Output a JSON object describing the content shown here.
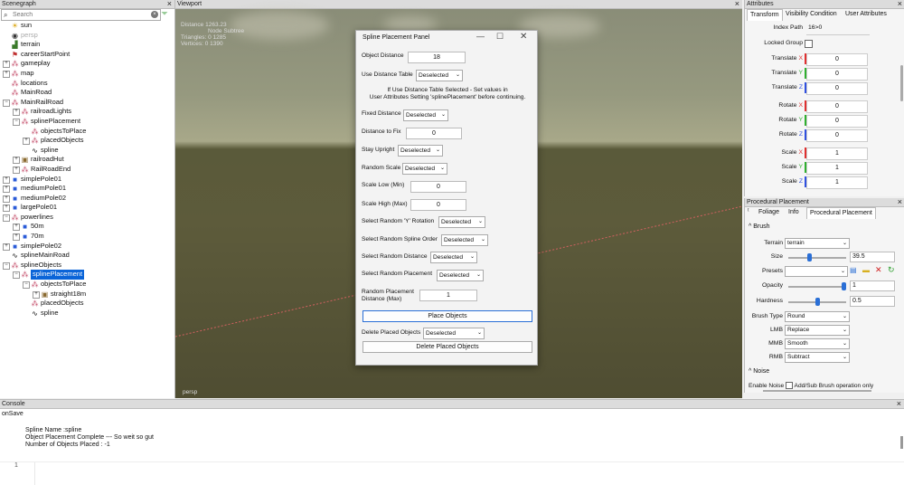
{
  "scenegraph": {
    "title": "Scenegraph",
    "search_placeholder": "Search",
    "nodes": [
      {
        "label": "sun",
        "depth": 0,
        "icon": "sun-icon"
      },
      {
        "label": "persp",
        "depth": 0,
        "icon": "camera-icon",
        "dim": true
      },
      {
        "label": "terrain",
        "depth": 0,
        "icon": "terrain-icon"
      },
      {
        "label": "careerStartPoint",
        "depth": 0,
        "icon": "object-icon"
      },
      {
        "label": "gameplay",
        "depth": 0,
        "icon": "group-icon",
        "expandable": true
      },
      {
        "label": "map",
        "depth": 0,
        "icon": "group-icon",
        "expandable": true
      },
      {
        "label": "locations",
        "depth": 0,
        "icon": "group-icon"
      },
      {
        "label": "MainRoad",
        "depth": 0,
        "icon": "group-icon"
      },
      {
        "label": "MainRailRoad",
        "depth": 0,
        "icon": "group-icon",
        "expandable": true,
        "open": true
      },
      {
        "label": "railroadLights",
        "depth": 1,
        "icon": "group-icon",
        "expandable": true
      },
      {
        "label": "splinePlacement",
        "depth": 1,
        "icon": "group-icon",
        "expandable": true,
        "open": true
      },
      {
        "label": "objectsToPlace",
        "depth": 2,
        "icon": "group-icon"
      },
      {
        "label": "placedObjects",
        "depth": 2,
        "icon": "group-icon",
        "expandable": true
      },
      {
        "label": "spline",
        "depth": 2,
        "icon": "spline-icon"
      },
      {
        "label": "railroadHut",
        "depth": 1,
        "icon": "model-icon",
        "expandable": true
      },
      {
        "label": "RailRoadEnd",
        "depth": 1,
        "icon": "group-icon",
        "expandable": true
      },
      {
        "label": "simplePole01",
        "depth": 0,
        "icon": "cube-icon",
        "expandable": true
      },
      {
        "label": "mediumPole01",
        "depth": 0,
        "icon": "cube-icon",
        "expandable": true
      },
      {
        "label": "mediumPole02",
        "depth": 0,
        "icon": "cube-icon",
        "expandable": true
      },
      {
        "label": "largePole01",
        "depth": 0,
        "icon": "cube-icon",
        "expandable": true
      },
      {
        "label": "powerlines",
        "depth": 0,
        "icon": "group-icon",
        "expandable": true,
        "open": true
      },
      {
        "label": "50m",
        "depth": 1,
        "icon": "cube-icon",
        "expandable": true
      },
      {
        "label": "70m",
        "depth": 1,
        "icon": "cube-icon",
        "expandable": true
      },
      {
        "label": "simplePole02",
        "depth": 0,
        "icon": "cube-icon",
        "expandable": true
      },
      {
        "label": "splineMainRoad",
        "depth": 0,
        "icon": "spline-icon"
      },
      {
        "label": "splineObjects",
        "depth": 0,
        "icon": "group-icon",
        "expandable": true,
        "open": true
      },
      {
        "label": "splinePlacement",
        "depth": 1,
        "icon": "group-icon",
        "expandable": true,
        "open": true,
        "selected": true
      },
      {
        "label": "objectsToPlace",
        "depth": 2,
        "icon": "group-icon",
        "expandable": true,
        "open": true
      },
      {
        "label": "straight18m",
        "depth": 3,
        "icon": "model-icon",
        "expandable": true
      },
      {
        "label": "placedObjects",
        "depth": 2,
        "icon": "group-icon"
      },
      {
        "label": "spline",
        "depth": 2,
        "icon": "spline-icon"
      }
    ]
  },
  "viewport": {
    "title": "Viewport",
    "stats": [
      "Distance 1263.23",
      "Node Subtree",
      "Triangles: 0      1285",
      "Vertices:   0      1390"
    ],
    "camera_label": "persp"
  },
  "panel": {
    "title": "Spline Placement Panel",
    "object_distance_label": "Object Distance",
    "object_distance_value": "18",
    "use_distance_table_label": "Use Distance Table",
    "use_distance_table_value": "Deselected",
    "note_line1": "If Use Distance Table Selected - Set values in",
    "note_line2": "User Attributes Setting 'splinePlacement' before continuing.",
    "fixed_distance_label": "Fixed Distance",
    "fixed_distance_value": "Deselected",
    "distance_to_fix_label": "Distance to Fix",
    "distance_to_fix_value": "0",
    "stay_upright_label": "Stay Upright",
    "stay_upright_value": "Deselected",
    "random_scale_label": "Random Scale",
    "random_scale_value": "Deselected",
    "scale_low_label": "Scale Low (Min)",
    "scale_low_value": "0",
    "scale_high_label": "Scale High (Max)",
    "scale_high_value": "0",
    "rand_y_rot_label": "Select Random 'Y' Rotation",
    "rand_y_rot_value": "Deselected",
    "rand_spline_order_label": "Select Random Spline Order",
    "rand_spline_order_value": "Deselected",
    "rand_distance_label": "Select Random Distance",
    "rand_distance_value": "Deselected",
    "rand_placement_label": "Select Random Placement",
    "rand_placement_value": "Deselected",
    "rand_place_dist_label1": "Random Placement",
    "rand_place_dist_label2": "Distance (Max)",
    "rand_place_dist_value": "1",
    "place_objects_button": "Place Objects",
    "delete_placed_label": "Delete Placed Objects",
    "delete_placed_value": "Deselected",
    "delete_placed_button": "Delete Placed Objects"
  },
  "attributes": {
    "title": "Attributes",
    "tabs": [
      "Transform",
      "Visibility Condition",
      "User Attributes"
    ],
    "index_path_label": "Index Path",
    "index_path_value": "16>0",
    "locked_group_label": "Locked Group",
    "fields": [
      {
        "label": "Translate",
        "axis": "X",
        "value": "0",
        "axis_color": "#e03030"
      },
      {
        "label": "Translate",
        "axis": "Y",
        "value": "0",
        "axis_color": "#30b030"
      },
      {
        "label": "Translate",
        "axis": "Z",
        "value": "0",
        "axis_color": "#3050e0"
      },
      {
        "label": "Rotate",
        "axis": "X",
        "value": "0",
        "axis_color": "#e03030"
      },
      {
        "label": "Rotate",
        "axis": "Y",
        "value": "0",
        "axis_color": "#30b030"
      },
      {
        "label": "Rotate",
        "axis": "Z",
        "value": "0",
        "axis_color": "#3050e0"
      },
      {
        "label": "Scale",
        "axis": "X",
        "value": "1",
        "axis_color": "#e03030"
      },
      {
        "label": "Scale",
        "axis": "Y",
        "value": "1",
        "axis_color": "#30b030"
      },
      {
        "label": "Scale",
        "axis": "Z",
        "value": "1",
        "axis_color": "#3050e0"
      }
    ]
  },
  "procedural": {
    "title": "Procedural Placement",
    "tabs": [
      "Foliage",
      "Info",
      "Procedural Placement"
    ],
    "brush_section": "Brush",
    "terrain_label": "Terrain",
    "terrain_value": "terrain",
    "size_label": "Size",
    "size_value": "39.5",
    "size_fraction": 0.35,
    "presets_label": "Presets",
    "opacity_label": "Opacity",
    "opacity_value": "1",
    "opacity_fraction": 1.0,
    "hardness_label": "Hardness",
    "hardness_value": "0.5",
    "hardness_fraction": 0.5,
    "brush_type_label": "Brush Type",
    "brush_type_value": "Round",
    "lmb_label": "LMB",
    "lmb_value": "Replace",
    "mmb_label": "MMB",
    "mmb_value": "Smooth",
    "rmb_label": "RMB",
    "rmb_value": "Subtract",
    "noise_section": "Noise",
    "enable_noise_label": "Enable Noise",
    "add_sub_label": "Add/Sub Brush operation only"
  },
  "console": {
    "title": "Console",
    "lines": [
      "onSave",
      "",
      "Spline Name :spline",
      "Object Placement Complete  ---  So weit so gut",
      "Number of Objects Placed : -1"
    ],
    "line_number": "1"
  }
}
